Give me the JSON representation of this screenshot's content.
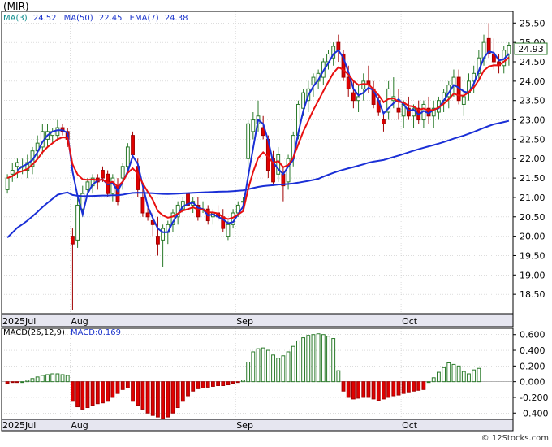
{
  "header": {
    "symbol": "(MIR)",
    "indicator_line": [
      {
        "label": "MA(3)",
        "value": "24.52",
        "color": "#1a33cc"
      },
      {
        "label": "MA(50)",
        "value": "22.45",
        "color": "#1a33cc"
      },
      {
        "label": "EMA(7)",
        "value": "24.38",
        "color": "#1a33cc"
      }
    ]
  },
  "last_price_badge": "24.93",
  "macd_header": {
    "params": "MACD(26,12,9)",
    "value": "MACD:0.169"
  },
  "watermark": "© 12Stocks.com",
  "colors": {
    "up": "#2a7a2a",
    "down": "#e00000",
    "ma_fast": "#1a2fd6",
    "ma_slow": "#1a2fd6",
    "ema": "#e81010",
    "grid": "#c8c8c8",
    "macd_pos": "#2a7a2a",
    "macd_neg": "#e00000"
  },
  "chart_data": [
    {
      "type": "candlestick",
      "title": "",
      "ylim": [
        18.0,
        25.8
      ],
      "y_ticks": [
        "25.50",
        "25.00",
        "24.50",
        "24.00",
        "23.50",
        "23.00",
        "22.50",
        "22.00",
        "21.50",
        "21.00",
        "20.50",
        "20.00",
        "19.50",
        "19.00",
        "18.50"
      ],
      "x_labels": [
        {
          "label": "2025Jul",
          "index": 0
        },
        {
          "label": "Aug",
          "index": 13
        },
        {
          "label": "Sep",
          "index": 46
        },
        {
          "label": "Oct",
          "index": 79
        }
      ],
      "grid": true,
      "candles": [
        [
          21.2,
          21.6,
          21.1,
          21.5
        ],
        [
          21.6,
          21.9,
          21.4,
          21.7
        ],
        [
          21.8,
          22.0,
          21.5,
          21.9
        ],
        [
          21.8,
          22.0,
          21.6,
          21.8
        ],
        [
          21.7,
          22.1,
          21.5,
          21.9
        ],
        [
          21.8,
          22.3,
          21.6,
          22.2
        ],
        [
          22.2,
          22.6,
          22.0,
          22.4
        ],
        [
          22.3,
          22.9,
          22.1,
          22.7
        ],
        [
          22.5,
          22.9,
          22.3,
          22.7
        ],
        [
          22.6,
          22.8,
          22.4,
          22.7
        ],
        [
          22.6,
          23.0,
          22.5,
          22.8
        ],
        [
          22.8,
          22.9,
          22.6,
          22.7
        ],
        [
          22.7,
          22.8,
          22.3,
          22.5
        ],
        [
          20.0,
          20.2,
          18.1,
          19.8
        ],
        [
          19.9,
          21.0,
          19.7,
          20.8
        ],
        [
          20.7,
          21.3,
          20.5,
          21.1
        ],
        [
          21.2,
          21.5,
          21.0,
          21.4
        ],
        [
          21.3,
          21.6,
          21.1,
          21.5
        ],
        [
          21.5,
          21.6,
          21.2,
          21.4
        ],
        [
          21.7,
          21.8,
          21.4,
          21.5
        ],
        [
          21.6,
          21.7,
          21.0,
          21.1
        ],
        [
          21.1,
          21.6,
          20.9,
          21.5
        ],
        [
          21.3,
          21.5,
          20.8,
          20.9
        ],
        [
          21.5,
          21.9,
          21.2,
          21.8
        ],
        [
          21.8,
          22.4,
          21.6,
          22.3
        ],
        [
          22.6,
          22.7,
          22.0,
          22.1
        ],
        [
          21.8,
          22.0,
          21.0,
          21.2
        ],
        [
          21.0,
          21.3,
          20.5,
          20.6
        ],
        [
          20.6,
          20.8,
          20.4,
          20.5
        ],
        [
          20.4,
          20.6,
          20.0,
          20.3
        ],
        [
          20.0,
          20.5,
          19.5,
          19.8
        ],
        [
          19.9,
          20.3,
          19.2,
          20.2
        ],
        [
          20.1,
          20.4,
          19.8,
          20.3
        ],
        [
          20.3,
          20.7,
          20.1,
          20.6
        ],
        [
          20.5,
          20.9,
          20.3,
          20.8
        ],
        [
          20.7,
          21.0,
          20.6,
          20.9
        ],
        [
          21.1,
          21.2,
          20.7,
          20.8
        ],
        [
          20.8,
          21.0,
          20.6,
          20.9
        ],
        [
          20.8,
          21.0,
          20.4,
          20.5
        ],
        [
          20.7,
          20.9,
          20.6,
          20.7
        ],
        [
          20.7,
          20.8,
          20.3,
          20.4
        ],
        [
          20.5,
          20.7,
          20.3,
          20.6
        ],
        [
          20.6,
          20.8,
          20.4,
          20.5
        ],
        [
          20.5,
          20.7,
          20.1,
          20.2
        ],
        [
          20.0,
          20.4,
          19.9,
          20.3
        ],
        [
          20.3,
          20.7,
          20.2,
          20.6
        ],
        [
          20.6,
          20.9,
          20.5,
          20.8
        ],
        [
          20.9,
          21.0,
          20.7,
          20.9
        ],
        [
          22.0,
          23.0,
          21.8,
          22.9
        ],
        [
          22.7,
          23.2,
          22.5,
          23.0
        ],
        [
          22.9,
          23.5,
          22.7,
          23.1
        ],
        [
          22.8,
          23.1,
          22.5,
          22.6
        ],
        [
          22.5,
          22.6,
          21.5,
          21.7
        ],
        [
          22.0,
          22.2,
          21.3,
          21.4
        ],
        [
          21.6,
          22.3,
          21.4,
          22.1
        ],
        [
          21.6,
          21.8,
          20.9,
          21.3
        ],
        [
          21.4,
          22.1,
          21.2,
          22.0
        ],
        [
          22.0,
          22.7,
          21.8,
          22.6
        ],
        [
          22.6,
          23.5,
          22.5,
          23.4
        ],
        [
          23.3,
          23.8,
          23.1,
          23.7
        ],
        [
          23.5,
          24.0,
          23.2,
          23.8
        ],
        [
          23.9,
          24.2,
          23.6,
          24.1
        ],
        [
          24.0,
          24.3,
          23.8,
          24.2
        ],
        [
          24.1,
          24.6,
          23.9,
          24.5
        ],
        [
          24.5,
          24.8,
          24.3,
          24.7
        ],
        [
          24.6,
          25.0,
          24.4,
          24.9
        ],
        [
          25.0,
          25.2,
          24.5,
          24.8
        ],
        [
          24.7,
          24.8,
          24.0,
          24.1
        ],
        [
          24.1,
          24.4,
          23.6,
          23.8
        ],
        [
          23.7,
          24.0,
          23.3,
          23.5
        ],
        [
          23.5,
          23.9,
          23.2,
          23.6
        ],
        [
          23.8,
          24.2,
          23.5,
          24.0
        ],
        [
          24.0,
          24.4,
          23.7,
          23.9
        ],
        [
          23.8,
          24.0,
          23.3,
          23.4
        ],
        [
          23.5,
          23.6,
          23.1,
          23.2
        ],
        [
          23.0,
          23.2,
          22.7,
          22.9
        ],
        [
          23.2,
          24.0,
          23.0,
          23.8
        ],
        [
          23.5,
          24.1,
          23.3,
          23.6
        ],
        [
          23.3,
          23.8,
          23.0,
          23.2
        ],
        [
          23.1,
          23.5,
          22.8,
          23.4
        ],
        [
          23.3,
          23.6,
          23.0,
          23.1
        ],
        [
          23.1,
          23.4,
          22.8,
          23.3
        ],
        [
          23.3,
          23.5,
          22.9,
          23.0
        ],
        [
          23.0,
          23.5,
          22.8,
          23.4
        ],
        [
          23.3,
          23.6,
          22.9,
          23.1
        ],
        [
          23.1,
          23.5,
          22.8,
          23.3
        ],
        [
          23.2,
          23.6,
          23.0,
          23.5
        ],
        [
          23.5,
          23.8,
          23.2,
          23.7
        ],
        [
          23.6,
          24.0,
          23.3,
          23.9
        ],
        [
          23.9,
          24.3,
          23.6,
          24.1
        ],
        [
          24.1,
          24.3,
          23.4,
          23.5
        ],
        [
          23.4,
          23.8,
          23.1,
          23.6
        ],
        [
          23.7,
          24.2,
          23.5,
          24.0
        ],
        [
          24.0,
          24.4,
          23.7,
          24.2
        ],
        [
          24.2,
          24.8,
          24.0,
          24.6
        ],
        [
          24.6,
          25.2,
          24.4,
          25.0
        ],
        [
          25.1,
          25.5,
          24.6,
          24.7
        ],
        [
          24.7,
          25.1,
          24.3,
          24.5
        ],
        [
          24.5,
          24.7,
          24.2,
          24.4
        ],
        [
          24.4,
          24.9,
          24.2,
          24.8
        ],
        [
          24.7,
          25.0,
          24.4,
          24.93
        ]
      ],
      "candle_fields": [
        "open",
        "high",
        "low",
        "close"
      ],
      "series": [
        {
          "name": "MA(3)",
          "color": "#1a2fd6"
        },
        {
          "name": "MA(50)",
          "color": "#1a2fd6"
        },
        {
          "name": "EMA(7)",
          "color": "#e81010"
        }
      ]
    },
    {
      "type": "bar",
      "title": "",
      "ylim": [
        -0.48,
        0.68
      ],
      "y_ticks": [
        "0.600",
        "0.400",
        "0.200",
        "0.000",
        "-0.200",
        "-0.400"
      ],
      "x_labels": [
        {
          "label": "2025Jul",
          "index": 0
        },
        {
          "label": "Aug",
          "index": 13
        },
        {
          "label": "Sep",
          "index": 46
        },
        {
          "label": "Oct",
          "index": 79
        }
      ],
      "grid": true,
      "values": [
        -0.02,
        -0.01,
        -0.01,
        0.0,
        0.02,
        0.04,
        0.06,
        0.08,
        0.09,
        0.1,
        0.1,
        0.09,
        0.08,
        -0.25,
        -0.32,
        -0.35,
        -0.33,
        -0.3,
        -0.28,
        -0.27,
        -0.25,
        -0.2,
        -0.15,
        -0.1,
        -0.08,
        -0.25,
        -0.3,
        -0.35,
        -0.4,
        -0.43,
        -0.45,
        -0.47,
        -0.45,
        -0.4,
        -0.33,
        -0.25,
        -0.18,
        -0.12,
        -0.09,
        -0.08,
        -0.07,
        -0.06,
        -0.05,
        -0.05,
        -0.04,
        -0.02,
        -0.01,
        0.02,
        0.25,
        0.38,
        0.42,
        0.43,
        0.4,
        0.34,
        0.3,
        0.33,
        0.38,
        0.45,
        0.52,
        0.56,
        0.59,
        0.6,
        0.61,
        0.6,
        0.58,
        0.55,
        0.14,
        -0.12,
        -0.2,
        -0.22,
        -0.21,
        -0.2,
        -0.2,
        -0.22,
        -0.24,
        -0.22,
        -0.2,
        -0.18,
        -0.17,
        -0.15,
        -0.13,
        -0.12,
        -0.11,
        -0.1,
        0.0,
        0.05,
        0.12,
        0.18,
        0.24,
        0.22,
        0.2,
        0.13,
        0.1,
        0.15,
        0.17
      ]
    }
  ]
}
